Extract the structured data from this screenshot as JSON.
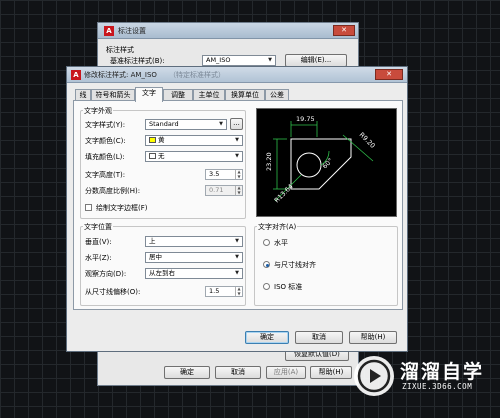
{
  "back_dialog": {
    "title": "标注设置",
    "section_label": "标注样式",
    "style_label": "基准标注样式(B):",
    "style_value": "AM_ISO",
    "edit_button": "编辑(E)...",
    "default_button": "恢复默认值(D)",
    "buttons": {
      "ok": "确定",
      "cancel": "取消",
      "apply": "应用(A)",
      "help": "帮助(H)"
    }
  },
  "front_dialog": {
    "title": "修改标注样式: AM_ISO",
    "title_extra": "（特定标准样式）",
    "tabs": [
      {
        "label": "线"
      },
      {
        "label": "符号和箭头"
      },
      {
        "label": "文字"
      },
      {
        "label": "调整"
      },
      {
        "label": "主单位"
      },
      {
        "label": "换算单位"
      },
      {
        "label": "公差"
      }
    ],
    "active_tab": "文字",
    "text_appearance": {
      "title": "文字外观",
      "style_label": "文字样式(Y):",
      "style_value": "Standard",
      "style_button": "...",
      "color_label": "文字颜色(C):",
      "color_value": "黄",
      "color_swatch": "#ffff00",
      "fill_label": "填充颜色(L):",
      "fill_value": "无",
      "height_label": "文字高度(T):",
      "height_value": "3.5",
      "fraction_label": "分数高度比例(H):",
      "fraction_value": "0.71",
      "frame_label": "绘制文字边框(F)"
    },
    "text_placement": {
      "title": "文字位置",
      "vertical_label": "垂直(V):",
      "vertical_value": "上",
      "horizontal_label": "水平(Z):",
      "horizontal_value": "居中",
      "view_dir_label": "观察方向(D):",
      "view_dir_value": "从左到右",
      "offset_label": "从尺寸线偏移(O):",
      "offset_value": "1.5"
    },
    "text_alignment": {
      "title": "文字对齐(A)",
      "options": [
        {
          "label": "水平",
          "selected": false
        },
        {
          "label": "与尺寸线对齐",
          "selected": true
        },
        {
          "label": "ISO 标准",
          "selected": false
        }
      ]
    },
    "preview_labels": {
      "top": "19.75",
      "left": "23.20",
      "bottom": "R13.64",
      "right": "R9.20",
      "angle": "60°"
    },
    "buttons": {
      "ok": "确定",
      "cancel": "取消",
      "help": "帮助(H)"
    }
  },
  "watermark": {
    "main": "溜溜自学",
    "sub": "ZIXUE.3D66.COM"
  }
}
